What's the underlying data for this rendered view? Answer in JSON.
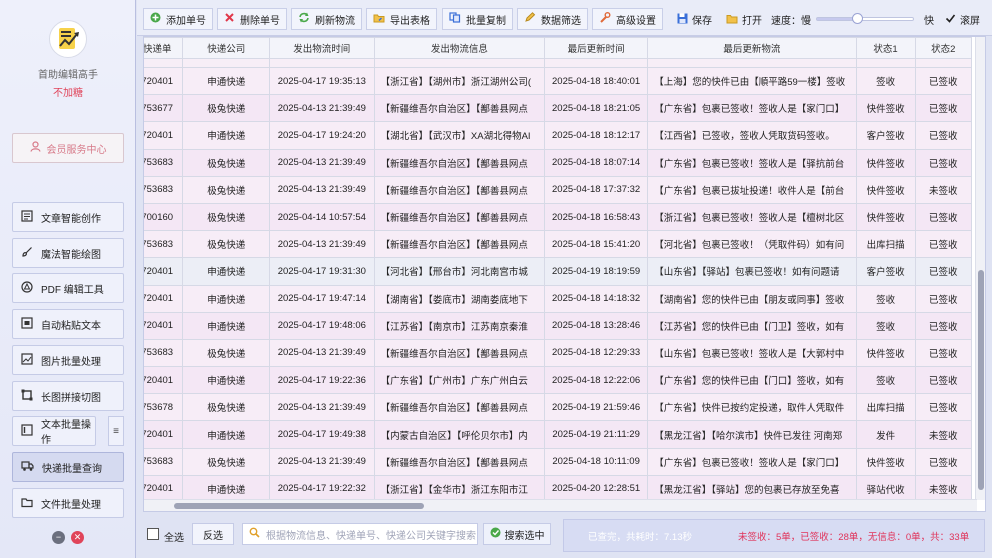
{
  "sidebar": {
    "brand": "首助编辑高手",
    "sub": "不加糖",
    "member_center": "会员服务中心",
    "items": [
      {
        "label": "文章智能创作",
        "icon": "document-icon"
      },
      {
        "label": "魔法智能绘图",
        "icon": "brush-icon"
      },
      {
        "label": "PDF 编辑工具",
        "icon": "pdf-icon"
      },
      {
        "label": "自动粘贴文本",
        "icon": "paste-icon"
      },
      {
        "label": "图片批量处理",
        "icon": "image-icon"
      },
      {
        "label": "长图拼接切图",
        "icon": "crop-icon"
      },
      {
        "label": "文本批量操作",
        "icon": "text-icon"
      },
      {
        "label": "快递批量查询",
        "icon": "truck-icon"
      },
      {
        "label": "文件批量处理",
        "icon": "folder-icon"
      }
    ],
    "menu_glyph": "≡",
    "minimize_glyph": "−",
    "close_glyph": "✕"
  },
  "toolbar": {
    "add": "添加单号",
    "delete": "删除单号",
    "refresh": "刷新物流",
    "export": "导出表格",
    "batch_copy": "批量复制",
    "filter": "数据筛选",
    "advanced": "高级设置",
    "save": "保存",
    "open": "打开",
    "speed_label": "速度：慢",
    "speed_fast": "快",
    "speed_value": 0.42,
    "scroll_label": "滚屏",
    "scroll_checked": true
  },
  "table": {
    "headers": [
      "快递单",
      "快递公司",
      "发出物流时间",
      "发出物流信息",
      "最后更新时间",
      "最后更新物流",
      "状态1",
      "状态2"
    ],
    "rows": [
      [
        "720401",
        "申通快递",
        "2025-04-17 19:35:13",
        "【浙江省】【湖州市】浙江湖州公司(",
        "2025-04-18 18:40:01",
        "【上海】您的快件已由【順平路59一楼】签收",
        "签收",
        "已签收"
      ],
      [
        "753677",
        "极兔快递",
        "2025-04-13 21:39:49",
        "【新疆维吾尔自治区】【鄯善县网点",
        "2025-04-18 18:21:05",
        "【广东省】包裹已签收！签收人是【家门口】",
        "快件签收",
        "已签收"
      ],
      [
        "720401",
        "申通快递",
        "2025-04-17 19:24:20",
        "【湖北省】【武汉市】XA湖北得物AI",
        "2025-04-18 18:12:17",
        "【江西省】已签收，签收人凭取货码签收。",
        "客户签收",
        "已签收"
      ],
      [
        "753683",
        "极兔快递",
        "2025-04-13 21:39:49",
        "【新疆维吾尔自治区】【鄯善县网点",
        "2025-04-18 18:07:14",
        "【广东省】包裹已签收！签收人是【驿抗前台",
        "快件签收",
        "已签收"
      ],
      [
        "753683",
        "极兔快递",
        "2025-04-13 21:39:49",
        "【新疆维吾尔自治区】【鄯善县网点",
        "2025-04-18 17:37:32",
        "【广东省】包裹已拔址投递！收件人是【前台",
        "快件签收",
        "未签收"
      ],
      [
        "700160",
        "极兔快递",
        "2025-04-14 10:57:54",
        "【新疆维吾尔自治区】【鄯善县网点",
        "2025-04-18 16:58:43",
        "【浙江省】包裹已签收！签收人是【檀树北区",
        "快件签收",
        "已签收"
      ],
      [
        "753683",
        "极兔快递",
        "2025-04-13 21:39:49",
        "【新疆维吾尔自治区】【鄯善县网点",
        "2025-04-18 15:41:20",
        "【河北省】包裹已签收！（凭取件码）如有问",
        "出库扫描",
        "已签收"
      ],
      [
        "720401",
        "申通快递",
        "2025-04-17 19:31:30",
        "【河北省】【邢台市】河北南宫市城",
        "2025-04-19 18:19:59",
        "【山东省】【驿站】包裹已签收！如有问题请",
        "客户签收",
        "已签收"
      ],
      [
        "720401",
        "申通快递",
        "2025-04-17 19:47:14",
        "【湖南省】【娄底市】湖南娄底地下",
        "2025-04-18 14:18:32",
        "【湖南省】您的快件已由【朋友或同事】签收",
        "签收",
        "已签收"
      ],
      [
        "720401",
        "申通快递",
        "2025-04-17 19:48:06",
        "【江苏省】【南京市】江苏南京秦淮",
        "2025-04-18 13:28:46",
        "【江苏省】您的快件已由【门卫】签收，如有",
        "签收",
        "已签收"
      ],
      [
        "753683",
        "极兔快递",
        "2025-04-13 21:39:49",
        "【新疆维吾尔自治区】【鄯善县网点",
        "2025-04-18 12:29:33",
        "【山东省】包裹已签收！签收人是【大郭村中",
        "快件签收",
        "已签收"
      ],
      [
        "720401",
        "申通快递",
        "2025-04-17 19:22:36",
        "【广东省】【广州市】广东广州白云",
        "2025-04-18 12:22:06",
        "【广东省】您的快件已由【门口】签收，如有",
        "签收",
        "已签收"
      ],
      [
        "753678",
        "极兔快递",
        "2025-04-13 21:39:49",
        "【新疆维吾尔自治区】【鄯善县网点",
        "2025-04-19 21:59:46",
        "【广东省】快件已按约定投递，取件人凭取件",
        "出库扫描",
        "已签收"
      ],
      [
        "720401",
        "申通快递",
        "2025-04-17 19:49:38",
        "【内蒙古自治区】【呼伦贝尔市】内",
        "2025-04-19 21:11:29",
        "【黑龙江省】【哈尔滨市】快件已发往 河南郑",
        "发件",
        "未签收"
      ],
      [
        "753683",
        "极兔快递",
        "2025-04-13 21:39:49",
        "【新疆维吾尔自治区】【鄯善县网点",
        "2025-04-18 10:11:09",
        "【广东省】包裹已签收！签收人是【家门口】",
        "快件签收",
        "已签收"
      ],
      [
        "720401",
        "申通快递",
        "2025-04-17 19:22:32",
        "【浙江省】【金华市】浙江东阳市江",
        "2025-04-20 12:28:51",
        "【黑龙江省】【驿站】您的包裹已存放至免喜",
        "驿站代收",
        "未签收"
      ]
    ]
  },
  "bottom": {
    "select_all": "全选",
    "invert": "反选",
    "search_placeholder": "根据物流信息、快递单号、快递公司关键字搜索",
    "search_selected": "搜索选中",
    "status_done": "已查完，共耗时：7.13秒",
    "status_counts": "未签收：5单，已签收：28单，无信息：0单，共：33单"
  },
  "colors": {
    "accent": "#5b6bd6",
    "status_red": "#e0335a",
    "row_pink": "#f4e7f5"
  }
}
